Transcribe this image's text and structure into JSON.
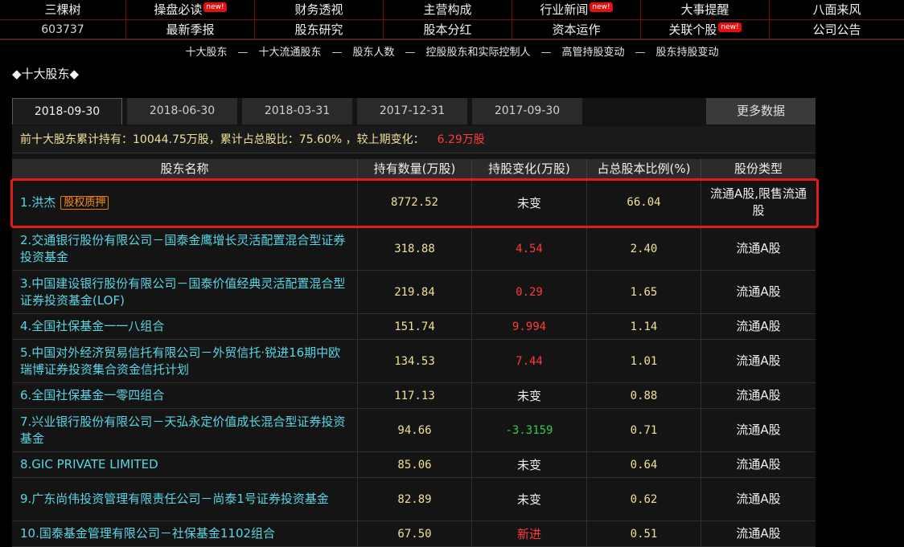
{
  "nav": {
    "row1": [
      {
        "label": "三棵树",
        "new": false
      },
      {
        "label": "操盘必读",
        "new": true
      },
      {
        "label": "财务透视",
        "new": false
      },
      {
        "label": "主营构成",
        "new": false
      },
      {
        "label": "行业新闻",
        "new": true
      },
      {
        "label": "大事提醒",
        "new": false
      },
      {
        "label": "八面来风",
        "new": false
      }
    ],
    "row2": [
      {
        "label": "603737",
        "new": false
      },
      {
        "label": "最新季报",
        "new": false
      },
      {
        "label": "股东研究",
        "new": false
      },
      {
        "label": "股本分红",
        "new": false
      },
      {
        "label": "资本运作",
        "new": false
      },
      {
        "label": "关联个股",
        "new": true
      },
      {
        "label": "公司公告",
        "new": false
      }
    ],
    "new_badge": "new!"
  },
  "sublinks": [
    "十大股东",
    "十大流通股东",
    "股东人数",
    "控股股东和实际控制人",
    "高管持股变动",
    "股东持股变动"
  ],
  "sublink_sep": "—",
  "section_title": "◆十大股东◆",
  "tabs": [
    "2018-09-30",
    "2018-06-30",
    "2018-03-31",
    "2017-12-31",
    "2017-09-30"
  ],
  "more_button": "更多数据",
  "summary": {
    "text": "前十大股东累计持有：10044.75万股，累计占总股比：75.60% ，较上期变化：",
    "change": "6.29万股"
  },
  "table": {
    "headers": [
      "股东名称",
      "持有数量(万股)",
      "持股变化(万股)",
      "占总股本比例(%)",
      "股份类型"
    ],
    "rows": [
      {
        "name": "1.洪杰",
        "tag": "股权质押",
        "qty": "8772.52",
        "chg": "未变",
        "chg_kind": "same",
        "pct": "66.04",
        "type": "流通A股,限售流通股",
        "h": 60
      },
      {
        "name": "2.交通银行股份有限公司－国泰金鹰增长灵活配置混合型证券投资基金",
        "tag": "",
        "qty": "318.88",
        "chg": "4.54",
        "chg_kind": "up",
        "pct": "2.40",
        "type": "流通A股",
        "h": 53
      },
      {
        "name": "3.中国建设银行股份有限公司－国泰价值经典灵活配置混合型证券投资基金(LOF)",
        "tag": "",
        "qty": "219.84",
        "chg": "0.29",
        "chg_kind": "up",
        "pct": "1.65",
        "type": "流通A股",
        "h": 53
      },
      {
        "name": "4.全国社保基金一一八组合",
        "tag": "",
        "qty": "151.74",
        "chg": "9.994",
        "chg_kind": "up",
        "pct": "1.14",
        "type": "流通A股",
        "h": 31
      },
      {
        "name": "5.中国对外经济贸易信托有限公司－外贸信托·锐进16期中欧瑞博证券投资集合资金信托计划",
        "tag": "",
        "qty": "134.53",
        "chg": "7.44",
        "chg_kind": "up",
        "pct": "1.01",
        "type": "流通A股",
        "h": 53
      },
      {
        "name": "6.全国社保基金一零四组合",
        "tag": "",
        "qty": "117.13",
        "chg": "未变",
        "chg_kind": "same",
        "pct": "0.88",
        "type": "流通A股",
        "h": 31
      },
      {
        "name": "7.兴业银行股份有限公司－天弘永定价值成长混合型证券投资基金",
        "tag": "",
        "qty": "94.66",
        "chg": "-3.3159",
        "chg_kind": "down",
        "pct": "0.71",
        "type": "流通A股",
        "h": 53
      },
      {
        "name": "8.GIC PRIVATE LIMITED",
        "tag": "",
        "qty": "85.06",
        "chg": "未变",
        "chg_kind": "same",
        "pct": "0.64",
        "type": "流通A股",
        "h": 31
      },
      {
        "name": "9.广东尚伟投资管理有限责任公司－尚泰1号证券投资基金",
        "tag": "",
        "qty": "82.89",
        "chg": "未变",
        "chg_kind": "same",
        "pct": "0.62",
        "type": "流通A股",
        "h": 53
      },
      {
        "name": "10.国泰基金管理有限公司－社保基金1102组合",
        "tag": "",
        "qty": "67.50",
        "chg": "新进",
        "chg_kind": "new",
        "pct": "0.51",
        "type": "流通A股",
        "h": 31
      }
    ]
  },
  "colors": {
    "nav_border": "#7a0f0f",
    "name_text": "#58d6e4",
    "value_text": "#f1e09a",
    "increase": "#ff3b3b",
    "decrease": "#2fcf4a",
    "highlight_box": "#e51b1b",
    "pledge_tag": "#ff8c1a"
  }
}
